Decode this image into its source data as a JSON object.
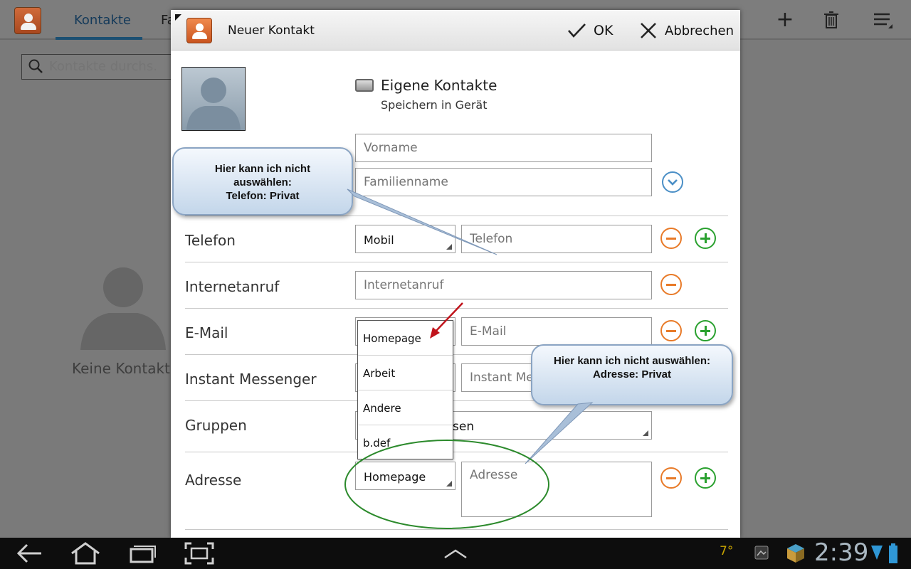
{
  "app": {
    "tab_contacts": "Kontakte",
    "tab_favorites": "Fa",
    "search_placeholder": "Kontakte durchs.",
    "empty_text": "Keine Kontakt"
  },
  "dialog": {
    "title": "Neuer Kontakt",
    "ok_label": "OK",
    "cancel_label": "Abbrechen",
    "account_name": "Eigene Kontakte",
    "account_sub": "Speichern in Gerät",
    "first_name_placeholder": "Vorname",
    "last_name_placeholder": "Familienname",
    "rows": {
      "phone": {
        "label": "Telefon",
        "type": "Mobil",
        "placeholder": "Telefon"
      },
      "internet_call": {
        "label": "Internetanruf",
        "placeholder": "Internetanruf"
      },
      "email": {
        "label": "E-Mail",
        "placeholder": "E-Mail"
      },
      "im": {
        "label": "Instant Messenger",
        "placeholder": "Instant Messenger"
      },
      "groups": {
        "label": "Gruppen",
        "value_visible": "sen"
      },
      "address": {
        "label": "Adresse",
        "type": "Homepage",
        "placeholder": "Adresse"
      }
    },
    "dropdown_options": [
      "Homepage",
      "Arbeit",
      "Andere",
      "b.def"
    ]
  },
  "annotations": {
    "callout_phone": [
      "Hier kann ich nicht",
      "auswählen:",
      "Telefon: Privat"
    ],
    "callout_address": [
      "Hier kann ich nicht auswählen:",
      "Adresse: Privat"
    ]
  },
  "status": {
    "temperature": "7°",
    "time": "2:39"
  },
  "colors": {
    "accent_orange": "#e87a28",
    "accent_green": "#2aa12f",
    "annotation_red": "#c0141c",
    "annotation_green": "#2c8a2c"
  }
}
